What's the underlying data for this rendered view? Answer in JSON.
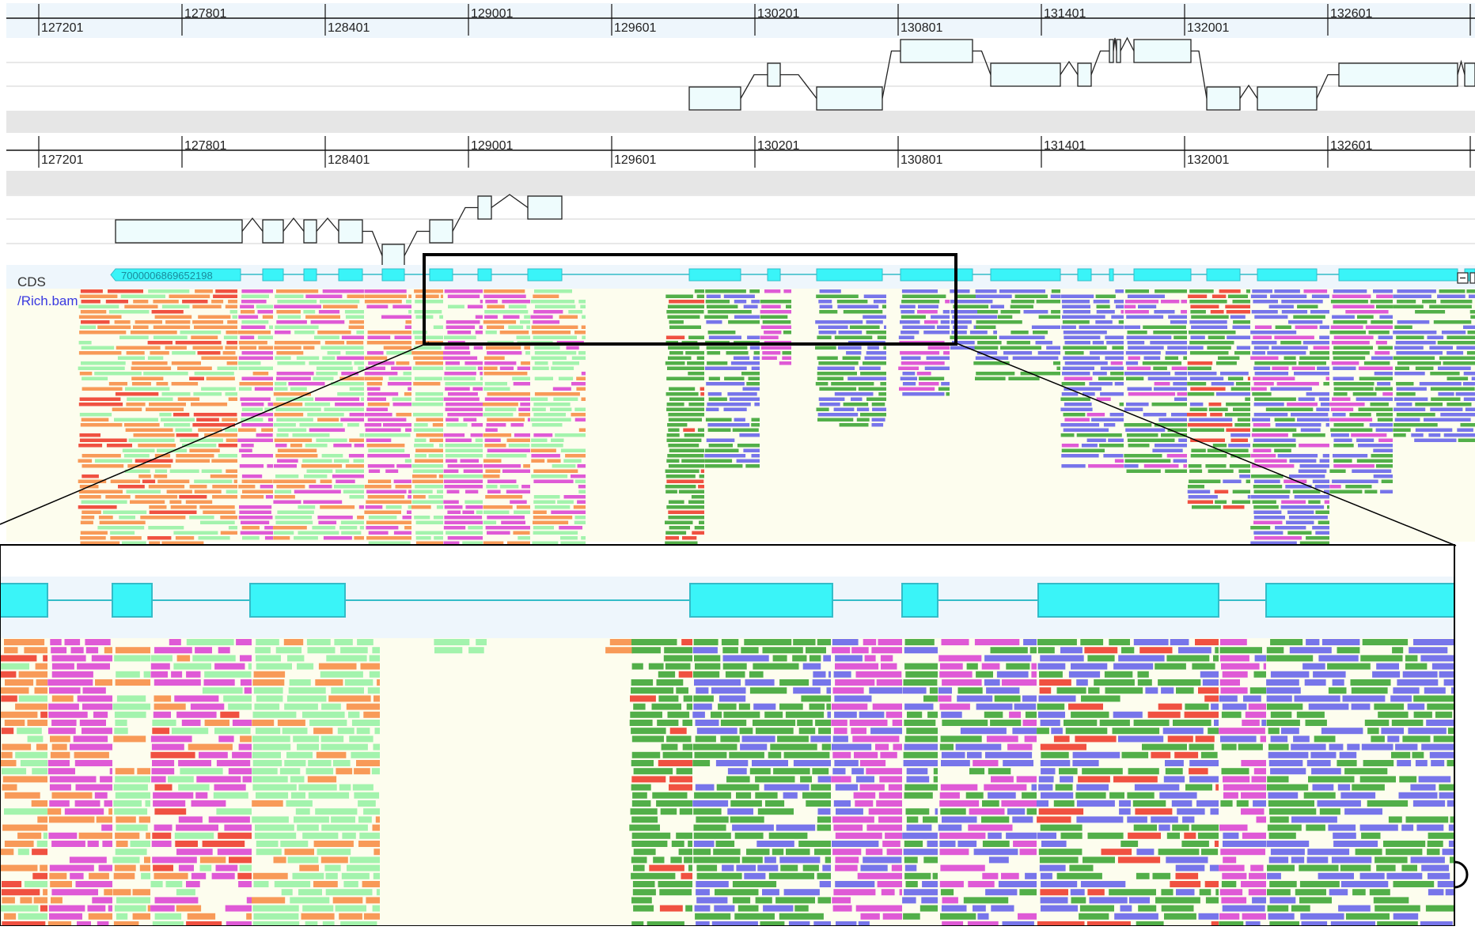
{
  "ruler_ticks": [
    "127201",
    "127801",
    "128401",
    "129001",
    "129601",
    "130201",
    "130801",
    "131401",
    "132001",
    "132601"
  ],
  "track_labels": {
    "cds": "CDS",
    "bam": "/Rich.bam"
  },
  "cds_feature_label": "7000006869652198",
  "colors": {
    "ruler_bg": "#eef6fc",
    "gray_band": "#e6e6e6",
    "feature_fill": "#eefcfd",
    "cds_fill": "#3af4f8",
    "cds_stroke": "#33bcc8",
    "cds_line": "#33bcc8",
    "reads_bg": "#fdfdee",
    "read_orange": "#f89a58",
    "read_lightgreen": "#a3f3ad",
    "read_magenta": "#df5ad6",
    "read_green": "#52af49",
    "read_blue": "#7775ea",
    "read_red": "#f05141",
    "label_blue": "#3a3ae0",
    "label_gray": "#333333",
    "cds_label": "#1a8a9a"
  },
  "icons": {
    "collapse": "minus-square-icon"
  }
}
